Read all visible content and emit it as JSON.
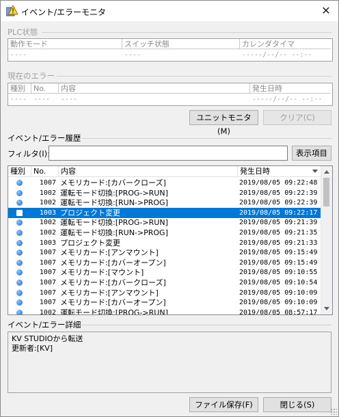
{
  "window": {
    "title": "イベント/エラーモニタ",
    "close_glyph": "✕"
  },
  "plc_status": {
    "label": "PLC状態",
    "headers": [
      "動作モード",
      "スイッチ状態",
      "カレンダタイマ"
    ],
    "values": [
      "----",
      "----",
      "-----/--/-- --:--"
    ]
  },
  "current_error": {
    "label": "現在のエラー",
    "headers": [
      "種別",
      "No.",
      "内容",
      "発生日時"
    ],
    "values": [
      "----",
      "----",
      "----",
      "-----/--/-- --:--"
    ]
  },
  "buttons": {
    "unit_monitor": "ユニットモニタ(M)",
    "clear": "クリア(C)",
    "display_items": "表示項目",
    "save_file": "ファイル保存(F)",
    "close": "閉じる(S)"
  },
  "history": {
    "label": "イベント/エラー履歴",
    "filter_label": "フィルタ(I):",
    "filter_value": "",
    "columns": [
      "種別",
      "No.",
      "内容",
      "発生日時"
    ],
    "sort_indicator": "descending",
    "rows": [
      {
        "type": "info",
        "no": "1007",
        "desc": "メモリカード:[カバークローズ]",
        "date": "2019/08/05 09:22:48",
        "selected": false
      },
      {
        "type": "info",
        "no": "1002",
        "desc": "運転モード切換:[PROG->RUN]",
        "date": "2019/08/05 09:22:39",
        "selected": false
      },
      {
        "type": "info",
        "no": "1002",
        "desc": "運転モード切換:[RUN->PROG]",
        "date": "2019/08/05 09:22:39",
        "selected": false
      },
      {
        "type": "info",
        "no": "1003",
        "desc": "プロジェクト変更",
        "date": "2019/08/05 09:22:17",
        "selected": true
      },
      {
        "type": "info",
        "no": "1002",
        "desc": "運転モード切換:[PROG->RUN]",
        "date": "2019/08/05 09:21:39",
        "selected": false
      },
      {
        "type": "info",
        "no": "1002",
        "desc": "運転モード切換:[RUN->PROG]",
        "date": "2019/08/05 09:21:35",
        "selected": false
      },
      {
        "type": "info",
        "no": "1003",
        "desc": "プロジェクト変更",
        "date": "2019/08/05 09:21:33",
        "selected": false
      },
      {
        "type": "info",
        "no": "1007",
        "desc": "メモリカード:[アンマウント]",
        "date": "2019/08/05 09:15:49",
        "selected": false
      },
      {
        "type": "info",
        "no": "1007",
        "desc": "メモリカード:[カバーオープン]",
        "date": "2019/08/05 09:15:49",
        "selected": false
      },
      {
        "type": "info",
        "no": "1007",
        "desc": "メモリカード:[マウント]",
        "date": "2019/08/05 09:10:55",
        "selected": false
      },
      {
        "type": "info",
        "no": "1007",
        "desc": "メモリカード:[カバークローズ]",
        "date": "2019/08/05 09:10:54",
        "selected": false
      },
      {
        "type": "info",
        "no": "1007",
        "desc": "メモリカード:[アンマウント]",
        "date": "2019/08/05 09:10:09",
        "selected": false
      },
      {
        "type": "info",
        "no": "1007",
        "desc": "メモリカード:[カバーオープン]",
        "date": "2019/08/05 09:10:09",
        "selected": false
      },
      {
        "type": "info",
        "no": "1002",
        "desc": "運転モード切換:[PROG->RUN]",
        "date": "2019/08/05 08:57:17",
        "selected": false
      }
    ]
  },
  "detail": {
    "label": "イベント/エラー詳細",
    "lines": [
      "KV STUDIOから転送",
      "更新者:[KV]"
    ]
  },
  "colors": {
    "selection": "#0078d7",
    "info_icon": "#1565c0"
  }
}
